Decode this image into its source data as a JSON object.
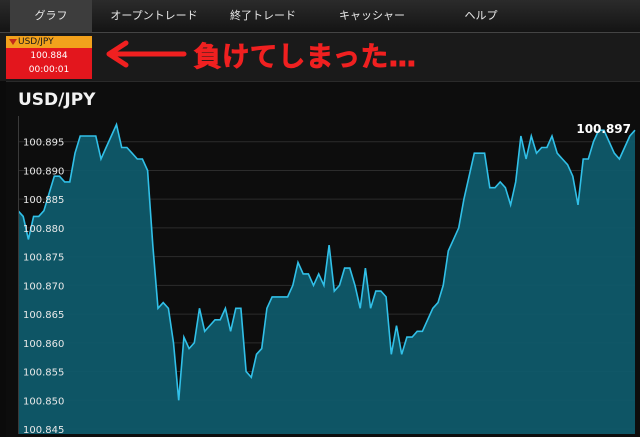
{
  "nav": {
    "tabs": [
      {
        "label": "グラフ",
        "active": true
      },
      {
        "label": "オープントレード",
        "active": false
      },
      {
        "label": "終了トレード",
        "active": false
      },
      {
        "label": "キャッシャー",
        "active": false
      },
      {
        "label": "ヘルプ",
        "active": false
      }
    ]
  },
  "ticker": {
    "symbol": "USD/JPY",
    "price": "100.884",
    "timer": "00:00:01"
  },
  "annotation": {
    "text": "負けてしまった…"
  },
  "chart_title": "USD/JPY",
  "colors": {
    "line": "#31c0e8",
    "fill": "#0f5a6a",
    "grid": "#2c2c2c",
    "accent_orange": "#f2a11c",
    "accent_red": "#e3161d"
  },
  "chart_data": {
    "type": "area",
    "title": "",
    "xlabel": "",
    "ylabel": "",
    "ylim": [
      100.845,
      100.9
    ],
    "y_ticks": [
      "100.895",
      "100.890",
      "100.885",
      "100.880",
      "100.875",
      "100.870",
      "100.865",
      "100.860",
      "100.855",
      "100.850",
      "100.845"
    ],
    "last_value_label": "100.897",
    "x": [
      0,
      1,
      2,
      3,
      4,
      5,
      6,
      7,
      8,
      9,
      10,
      11,
      12,
      13,
      14,
      15,
      16,
      17,
      18,
      19,
      20,
      21,
      22,
      23,
      24,
      25,
      26,
      27,
      28,
      29,
      30,
      31,
      32,
      33,
      34,
      35,
      36,
      37,
      38,
      39,
      40,
      41,
      42,
      43,
      44,
      45,
      46,
      47,
      48,
      49,
      50,
      51,
      52,
      53,
      54,
      55,
      56,
      57,
      58,
      59,
      60,
      61,
      62,
      63,
      64,
      65,
      66,
      67,
      68,
      69,
      70,
      71,
      72,
      73,
      74,
      75,
      76,
      77,
      78,
      79,
      80,
      81,
      82,
      83,
      84,
      85,
      86,
      87,
      88,
      89,
      90,
      91,
      92,
      93,
      94,
      95,
      96,
      97,
      98,
      99,
      100,
      101,
      102,
      103,
      104,
      105,
      106,
      107,
      108,
      109,
      110,
      111,
      112,
      113,
      114,
      115,
      116,
      117,
      118,
      119
    ],
    "values": [
      100.883,
      100.882,
      100.878,
      100.882,
      100.882,
      100.883,
      100.886,
      100.889,
      100.889,
      100.888,
      100.888,
      100.893,
      100.896,
      100.896,
      100.896,
      100.896,
      100.892,
      100.894,
      100.896,
      100.898,
      100.894,
      100.894,
      100.893,
      100.892,
      100.892,
      100.89,
      100.877,
      100.866,
      100.867,
      100.866,
      100.86,
      100.85,
      100.861,
      100.859,
      100.86,
      100.866,
      100.862,
      100.863,
      100.864,
      100.864,
      100.866,
      100.862,
      100.866,
      100.866,
      100.855,
      100.854,
      100.858,
      100.859,
      100.866,
      100.868,
      100.868,
      100.868,
      100.868,
      100.87,
      100.874,
      100.872,
      100.872,
      100.87,
      100.872,
      100.87,
      100.877,
      100.869,
      100.87,
      100.873,
      100.873,
      100.87,
      100.866,
      100.873,
      100.866,
      100.869,
      100.869,
      100.868,
      100.858,
      100.863,
      100.858,
      100.861,
      100.861,
      100.862,
      100.862,
      100.864,
      100.866,
      100.867,
      100.87,
      100.876,
      100.878,
      100.88,
      100.885,
      100.889,
      100.893,
      100.893,
      100.893,
      100.887,
      100.887,
      100.888,
      100.887,
      100.884,
      100.888,
      100.896,
      100.892,
      100.896,
      100.893,
      100.894,
      100.894,
      100.896,
      100.893,
      100.892,
      100.891,
      100.889,
      100.884,
      100.892,
      100.892,
      100.895,
      100.897,
      100.897,
      100.895,
      100.893,
      100.892,
      100.894,
      100.896,
      100.897
    ]
  }
}
